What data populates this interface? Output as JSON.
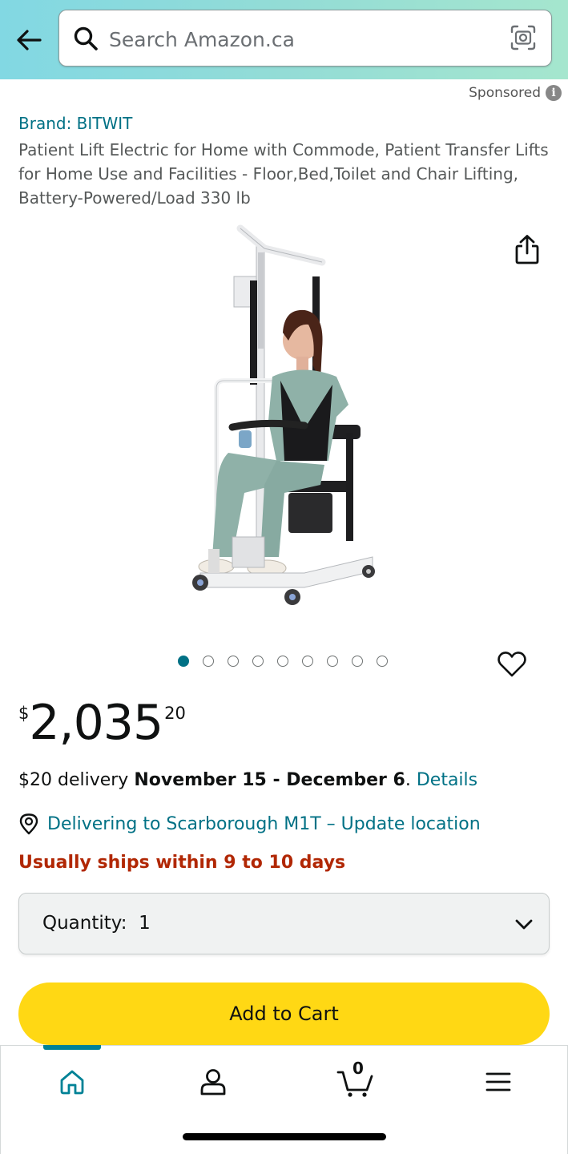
{
  "header": {
    "search_placeholder": "Search Amazon.ca"
  },
  "ad": {
    "sponsored_label": "Sponsored",
    "info_glyph": "i"
  },
  "product": {
    "brand": "Brand: BITWIT",
    "title": "Patient Lift Electric for Home with Commode, Patient Transfer Lifts for Home Use and Facilities - Floor,Bed,Toilet and Chair Lifting, Battery-Powered/Load 330 lb",
    "image_count": 9,
    "active_image": 1,
    "price": {
      "symbol": "$",
      "whole": "2,035",
      "fraction": "20"
    },
    "delivery": {
      "prefix": "$20 delivery ",
      "dates": "November 15 - December 6",
      "separator": ". ",
      "details_link": "Details"
    },
    "location": {
      "text": "Delivering to Scarborough M1T – Update location"
    },
    "availability": "Usually ships within 9 to 10 days",
    "quantity": {
      "label": "Quantity:",
      "value": "1"
    },
    "add_to_cart": "Add to Cart"
  },
  "bottom_nav": {
    "cart_count": "0",
    "active_tab": "home",
    "items": [
      "home-icon",
      "account-icon",
      "cart-icon",
      "menu-icon"
    ]
  },
  "colors": {
    "link": "#007185",
    "availability": "#b12704",
    "add_to_cart_bg": "#ffd814",
    "header_gradient_start": "#82d8e3",
    "header_gradient_end": "#a5e6ce"
  }
}
